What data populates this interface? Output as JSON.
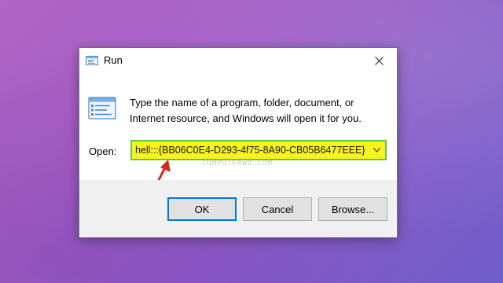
{
  "window": {
    "title": "Run",
    "title_icon": "run-app-icon",
    "close_icon": "close-icon"
  },
  "dialog": {
    "app_icon": "run-app-icon",
    "description": "Type the name of a program, folder, document, or Internet resource, and Windows will open it for you.",
    "open_label": "Open:",
    "open_value": "hell:::{BB06C0E4-D293-4f75-8A90-CB05B6477EEE}",
    "dropdown_icon": "chevron-down-icon",
    "highlight_color": "#f7f31d",
    "highlight_border_color": "#6cc14a"
  },
  "watermark": "COMPUTERWD.COM",
  "annotation": {
    "arrow_icon": "red-arrow-icon",
    "arrow_color": "#d7261e"
  },
  "buttons": {
    "ok": "OK",
    "cancel": "Cancel",
    "browse": "Browse..."
  }
}
